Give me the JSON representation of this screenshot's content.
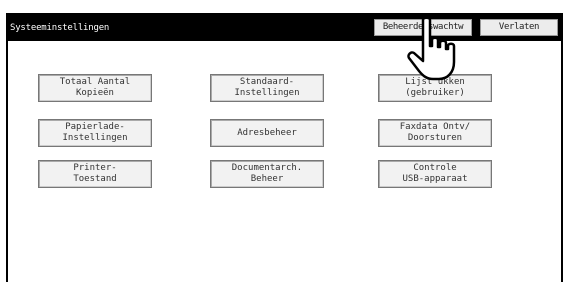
{
  "window": {
    "title": "Systeeminstellingen",
    "admin_button": "Beheerderswachtw",
    "exit_button": "Verlaten"
  },
  "menu": [
    {
      "label": "Totaal Aantal\nKopieën"
    },
    {
      "label": "Standaard-\nInstellingen"
    },
    {
      "label": "Lijst     ukken\n(gebruiker)"
    },
    {
      "label": "Papierlade-\nInstellingen"
    },
    {
      "label": "Adresbeheer"
    },
    {
      "label": "Faxdata Ontv/\nDoorsturen"
    },
    {
      "label": "Printer-\nToestand"
    },
    {
      "label": "Documentarch.\nBeheer"
    },
    {
      "label": "Controle\nUSB-apparaat"
    }
  ],
  "icons": {
    "pointer": "hand-pointer-icon"
  }
}
